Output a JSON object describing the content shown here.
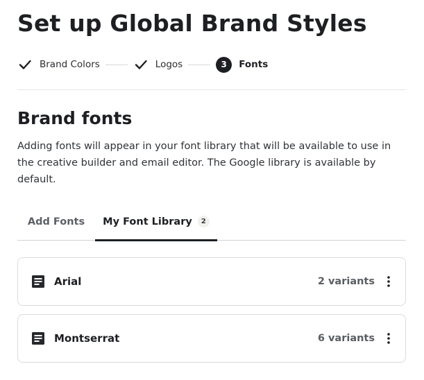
{
  "page": {
    "title": "Set up Global Brand Styles"
  },
  "stepper": {
    "steps": [
      {
        "label": "Brand Colors",
        "state": "complete",
        "icon": "check-icon"
      },
      {
        "label": "Logos",
        "state": "complete",
        "icon": "check-icon"
      },
      {
        "label": "Fonts",
        "state": "current",
        "number": "3"
      }
    ]
  },
  "section": {
    "title": "Brand fonts",
    "description": "Adding fonts will appear in your font library that will be available to use in the creative builder and email editor. The Google library is available by default."
  },
  "tabs": {
    "add_fonts": {
      "label": "Add Fonts",
      "active": false
    },
    "my_font_library": {
      "label": "My Font Library",
      "badge": "2",
      "active": true
    }
  },
  "fonts": [
    {
      "name": "Arial",
      "variants": "2 variants",
      "icon": "font-file-icon",
      "menu_icon": "more-vertical-icon"
    },
    {
      "name": "Montserrat",
      "variants": "6 variants",
      "icon": "font-file-icon",
      "menu_icon": "more-vertical-icon"
    }
  ],
  "colors": {
    "primary_text": "#1d1f22",
    "secondary_text": "#5a5e63",
    "border": "#d9dbde",
    "badge_bg": "#f0f1ec"
  }
}
